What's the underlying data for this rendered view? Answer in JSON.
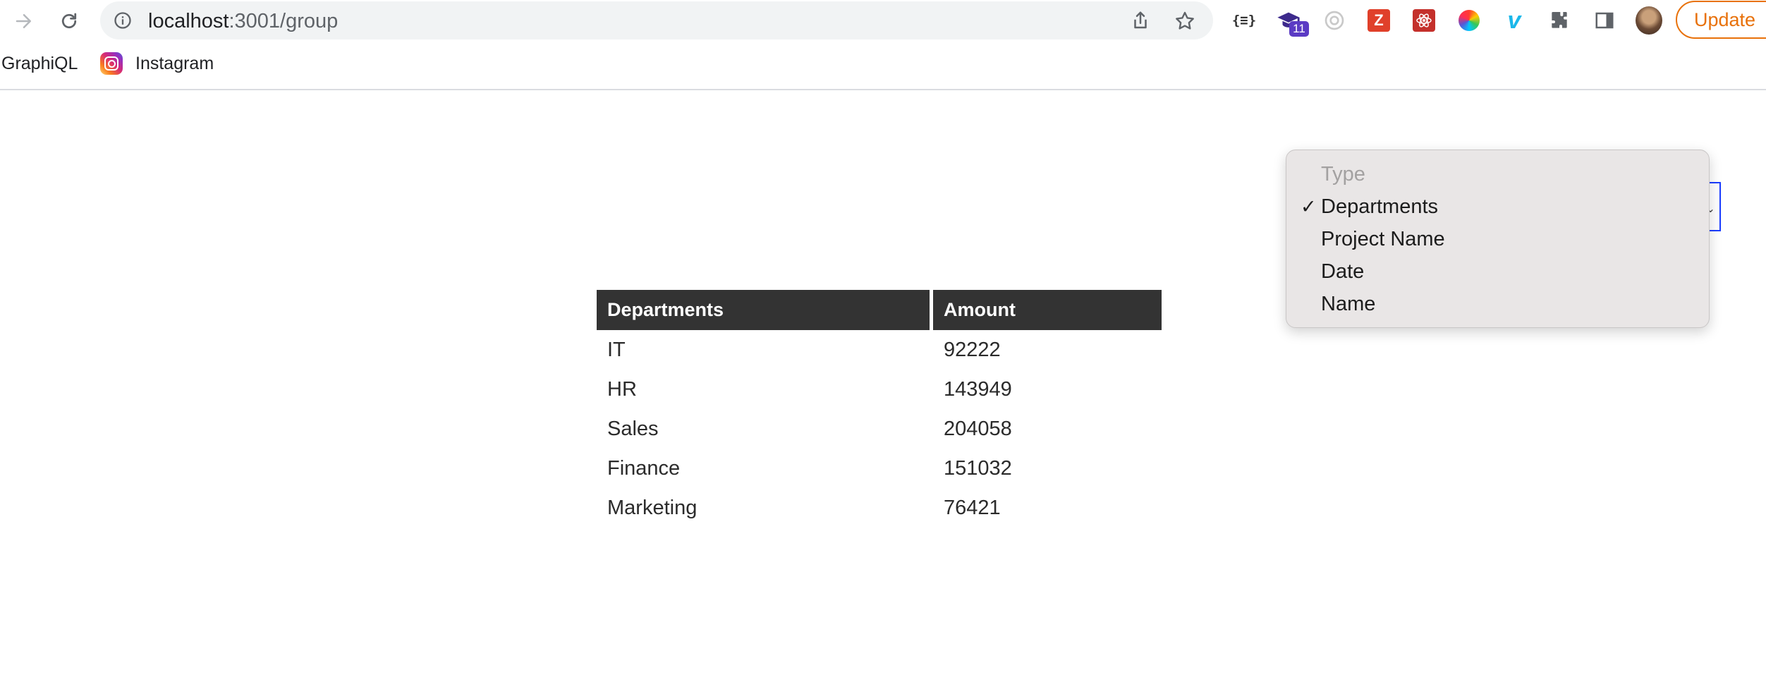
{
  "browser": {
    "url_host": "localhost",
    "url_rest": ":3001/group",
    "update_label": "Update",
    "extension_badge": "11",
    "icons": [
      "forward-arrow-icon",
      "reload-icon",
      "site-info-icon",
      "share-icon",
      "star-icon",
      "json-formatter-icon",
      "graduation-cap-icon",
      "circle-extension-icon",
      "zotero-icon",
      "react-devtools-icon",
      "color-picker-icon",
      "vimeo-icon",
      "puzzle-extensions-icon",
      "side-panel-icon",
      "profile-avatar"
    ]
  },
  "bookmarks": [
    {
      "label": "GraphiQL"
    },
    {
      "label": "Instagram",
      "icon": "instagram-icon"
    }
  ],
  "dropdown": {
    "placeholder": "Type",
    "selected": "Departments",
    "options": [
      "Departments",
      "Project Name",
      "Date",
      "Name"
    ]
  },
  "table": {
    "headers": [
      "Departments",
      "Amount"
    ],
    "rows": [
      [
        "IT",
        "92222"
      ],
      [
        "HR",
        "143949"
      ],
      [
        "Sales",
        "204058"
      ],
      [
        "Finance",
        "151032"
      ],
      [
        "Marketing",
        "76421"
      ]
    ]
  },
  "colors": {
    "accent_update": "#e8710a",
    "table_header_bg": "#333333",
    "select_border": "#1a3cff",
    "dropdown_bg": "#e9e6e6"
  }
}
